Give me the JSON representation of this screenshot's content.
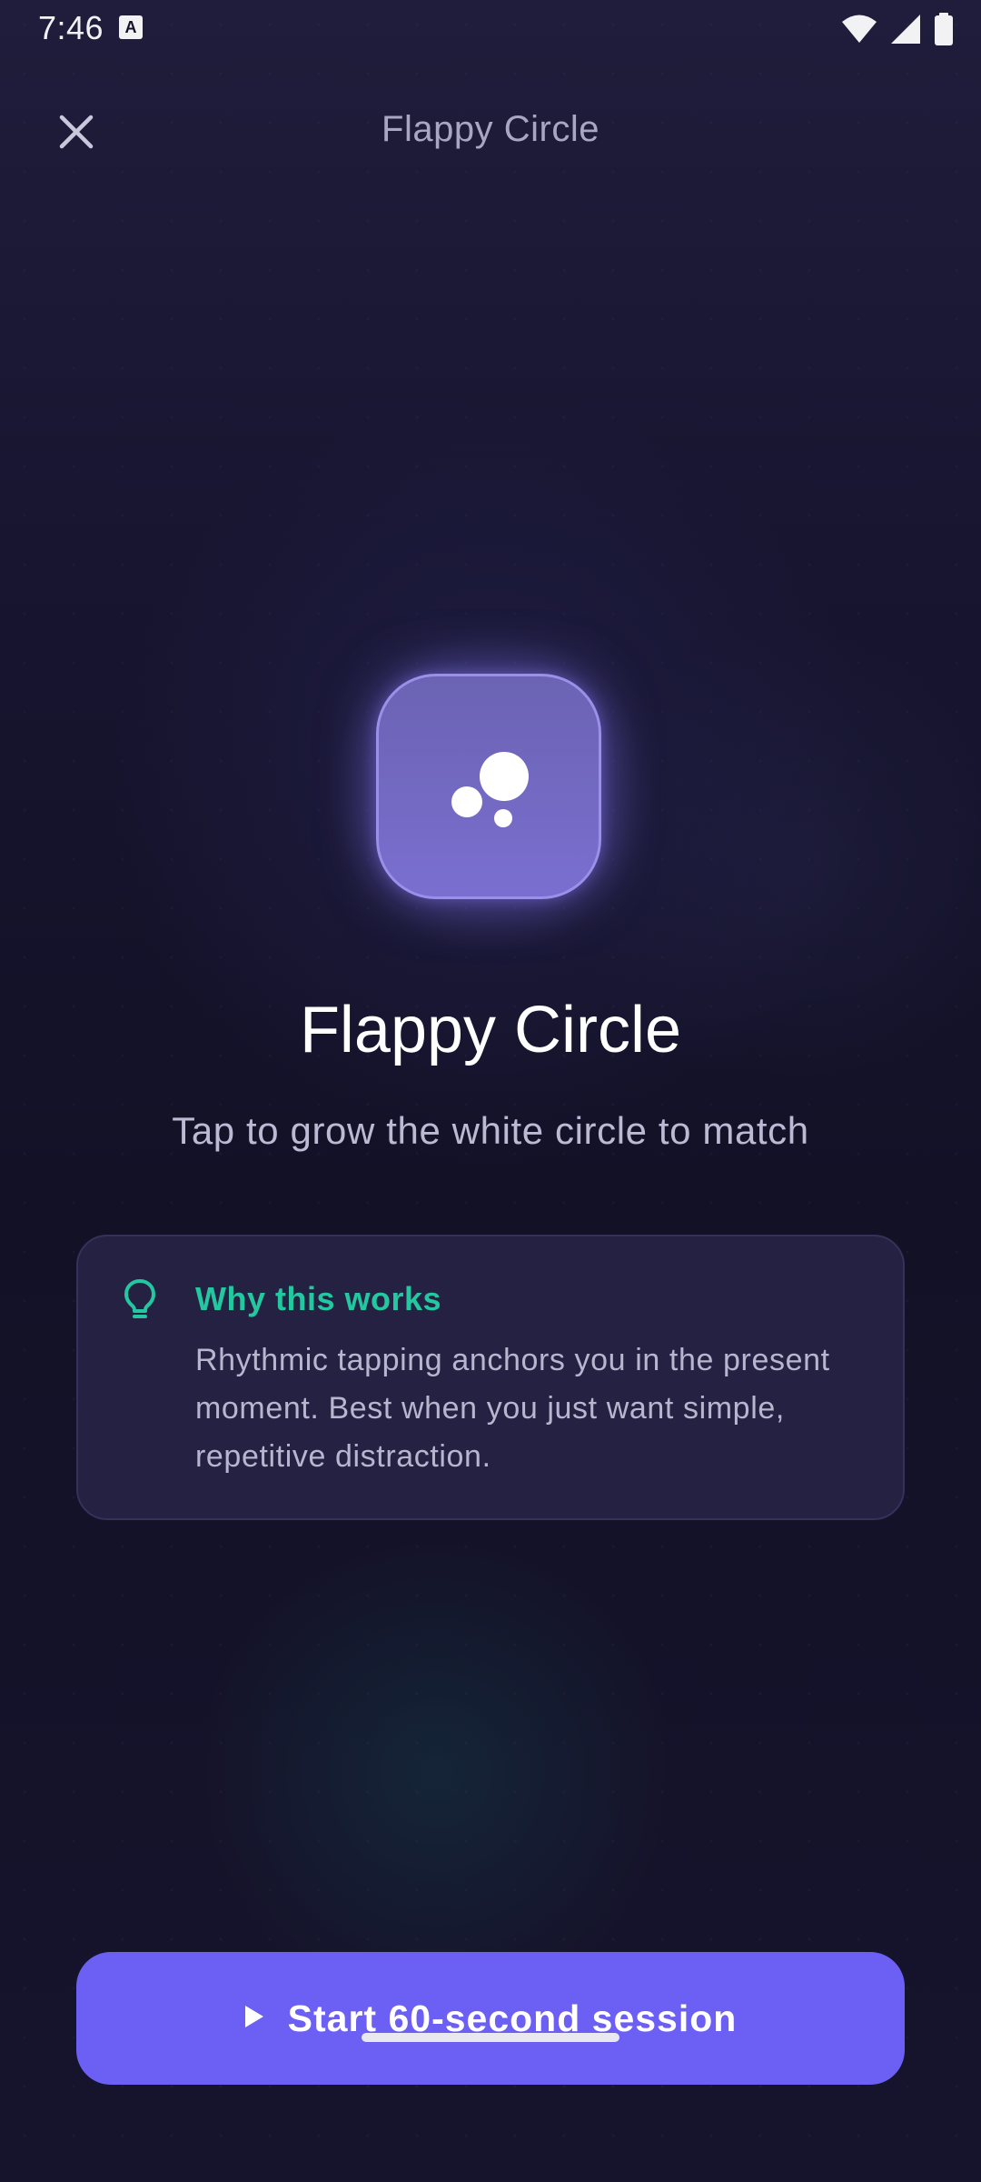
{
  "status_bar": {
    "time": "7:46",
    "notification_badge": "A",
    "icons": [
      "wifi-icon",
      "signal-icon",
      "battery-icon"
    ]
  },
  "top_bar": {
    "close_icon": "close-icon",
    "title": "Flappy Circle"
  },
  "hero": {
    "icon": "bubbles-icon",
    "title": "Flappy Circle",
    "subtitle": "Tap to grow the white circle to match"
  },
  "info_card": {
    "icon": "lightbulb-icon",
    "heading": "Why this works",
    "body": "Rhythmic tapping anchors you in the present moment. Best when you just want simple, repetitive distraction."
  },
  "start_button": {
    "icon": "play-icon",
    "label": "Start 60-second session"
  },
  "colors": {
    "accent": "#6c5ff4",
    "heading_green": "#23c8a0",
    "background": "#151327"
  }
}
